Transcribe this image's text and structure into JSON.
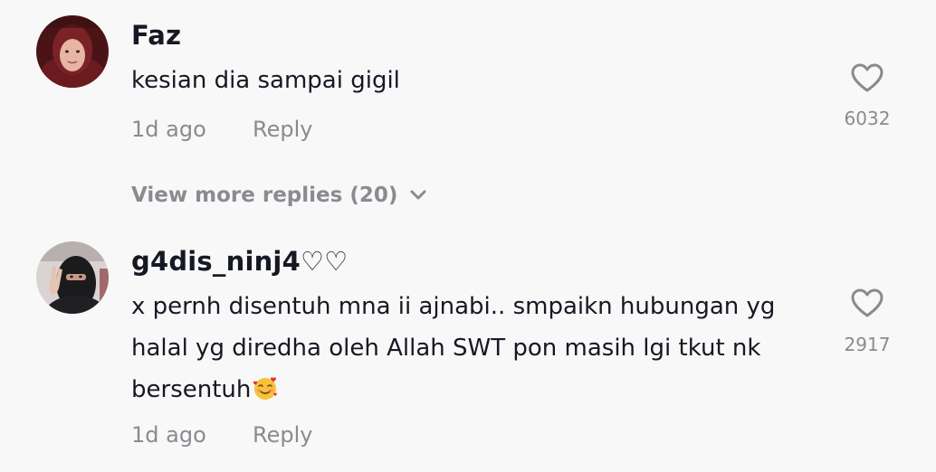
{
  "comments": [
    {
      "username": "Faz",
      "text": "kesian dia sampai gigil",
      "time": "1d ago",
      "reply_label": "Reply",
      "likes": "6032",
      "avatar_icon": "user-avatar-hijab-red"
    },
    {
      "username": "g4dis_ninj4♡♡",
      "text": "x pernh disentuh mna ii ajnabi.. smpaikn hubungan yg halal yg diredha oleh Allah SWT pon masih lgi tkut nk bersentuh",
      "emoji": "🥰",
      "time": "1d ago",
      "reply_label": "Reply",
      "likes": "2917",
      "avatar_icon": "user-avatar-niqab-peace-sign"
    }
  ],
  "view_more": {
    "label": "View more replies (20)"
  },
  "colors": {
    "background": "#f8f8f8",
    "primary_text": "#161823",
    "secondary_text": "#8a8b91"
  },
  "icons": {
    "like": "heart-outline-icon",
    "expand": "chevron-down-icon"
  }
}
